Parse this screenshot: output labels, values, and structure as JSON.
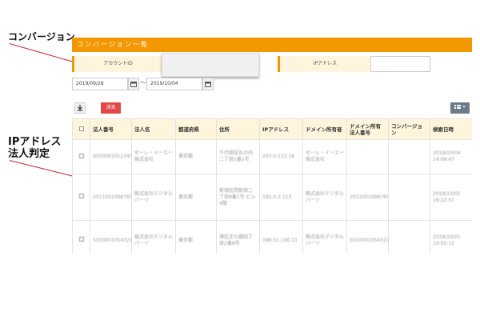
{
  "callouts": {
    "conversion": "コンバージョン",
    "ip_line1": "IPアドレス",
    "ip_line2": "法人判定"
  },
  "header": {
    "title": "コンバージョン一覧"
  },
  "filters": {
    "account_label": "アカウントID",
    "account_value": "",
    "ip_label": "IPアドレス",
    "ip_value": "",
    "date_from": "2019/09/28",
    "date_to": "2019/10/04",
    "separator": "〜"
  },
  "toolbar": {
    "download_icon": "download-icon",
    "delete_label": "消去",
    "view_icon": "grid-icon"
  },
  "table": {
    "columns": [
      "法人番号",
      "法人名",
      "都道府県",
      "住所",
      "IPアドレス",
      "ドメイン所有者",
      "ドメイン所有法人番号",
      "コンバージョン",
      "検索日時"
    ],
    "rows": [
      {
        "cells": [
          "9010001012345",
          "ゼーレ・イーエー株式会社",
          "東京都",
          "千代田区丸の内二丁目1番1号",
          "203.0.113.16",
          "ゼーレ・イーエー株式会社",
          "",
          "",
          "2019/10/04 14:08:47"
        ]
      },
      {
        "cells": [
          "2011001098765",
          "株式会社デジタルパーツ",
          "東京都",
          "新宿区西新宿二丁目8番1号 ビル4階",
          "192.0.2.113",
          "株式会社デジタルパーツ",
          "2011001098765",
          "",
          "2019/10/02 16:22:51"
        ]
      },
      {
        "cells": [
          "5010001054321",
          "株式会社デジタルパーツ",
          "東京都",
          "港区芝公園四丁目2番8号",
          "198.51.100.11",
          "株式会社デジタルパーツ",
          "5010001054321",
          "",
          "2019/10/01 10:55:12"
        ]
      }
    ]
  }
}
